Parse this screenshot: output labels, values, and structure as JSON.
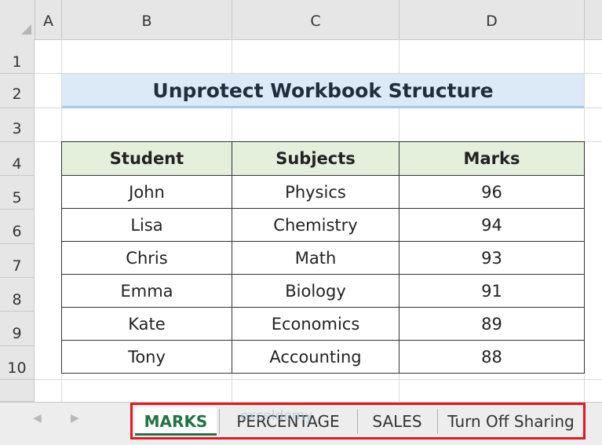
{
  "columns": [
    "A",
    "B",
    "C",
    "D"
  ],
  "rows": [
    "1",
    "2",
    "3",
    "4",
    "5",
    "6",
    "7",
    "8",
    "9",
    "10"
  ],
  "title": "Unprotect Workbook Structure",
  "table": {
    "headers": [
      "Student",
      "Subjects",
      "Marks"
    ],
    "rows": [
      [
        "John",
        "Physics",
        "96"
      ],
      [
        "Lisa",
        "Chemistry",
        "94"
      ],
      [
        "Chris",
        "Math",
        "93"
      ],
      [
        "Emma",
        "Biology",
        "91"
      ],
      [
        "Kate",
        "Economics",
        "89"
      ],
      [
        "Tony",
        "Accounting",
        "88"
      ]
    ]
  },
  "sheet_tabs": [
    "MARKS",
    "PERCENTAGE",
    "SALES",
    "Turn Off Sharing"
  ],
  "active_tab": "MARKS",
  "nav_icons": [
    "chevron-left-icon",
    "chevron-right-icon"
  ],
  "watermark": "exceldemy",
  "colors": {
    "accent": "#217346",
    "highlight": "#e01b24",
    "title_bg": "#dce9f6",
    "header_bg": "#e4efdc"
  }
}
